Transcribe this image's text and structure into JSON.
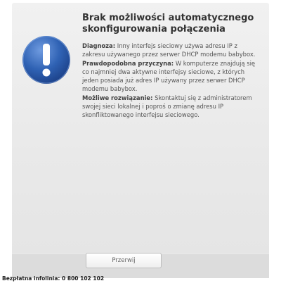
{
  "dialog": {
    "title": "Brak możliwości automatycznego skonfigurowania połączenia",
    "diagnosis_label": "Diagnoza:",
    "diagnosis_text": "Inny interfejs sieciowy używa adresu IP z zakresu używanego przez serwer DHCP modemu babybox.",
    "cause_label": "Prawdopodobna przyczyna:",
    "cause_text": "W komputerze znajdują się co najmniej dwa aktywne interfejsy sieciowe, z których jeden posiada już adres IP używany przez serwer DHCP modemu babybox.",
    "solution_label": "Możliwe rozwiązanie:",
    "solution_text": "Skontaktuj się z administratorem swojej sieci lokalnej i poproś o zmianę adresu IP skonfliktowanego interfejsu sieciowego.",
    "button_label": "Przerwij"
  },
  "footer": {
    "hotline": "Bezpłatna infolinia: 0 800 102 102"
  },
  "colors": {
    "icon_blue": "#2a5aa8",
    "dialog_bg": "#ececec",
    "footer_bg": "#dcdcdc"
  },
  "icons": {
    "alert": "exclamation-icon"
  }
}
